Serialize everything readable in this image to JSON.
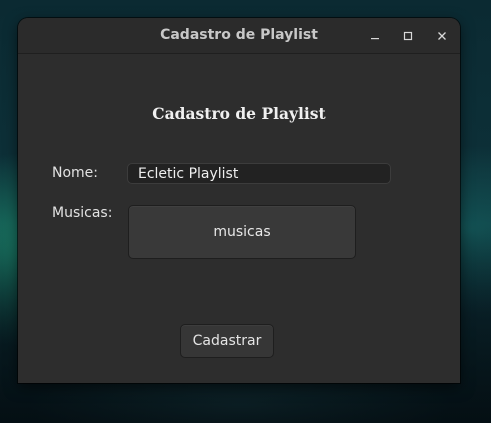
{
  "window": {
    "title": "Cadastro de Playlist",
    "controls": {
      "minimize_icon": "minimize-icon",
      "maximize_icon": "maximize-icon",
      "close_icon": "close-icon"
    }
  },
  "form": {
    "heading": "Cadastro de Playlist",
    "nome_label": "Nome:",
    "nome_value": "Ecletic Playlist",
    "musicas_label": "Musicas:",
    "musicas_button_label": "musicas",
    "submit_label": "Cadastrar"
  },
  "colors": {
    "window_background": "#2d2d2d",
    "input_background": "#222222",
    "button_background": "#363636",
    "text": "#e4e4e4"
  }
}
